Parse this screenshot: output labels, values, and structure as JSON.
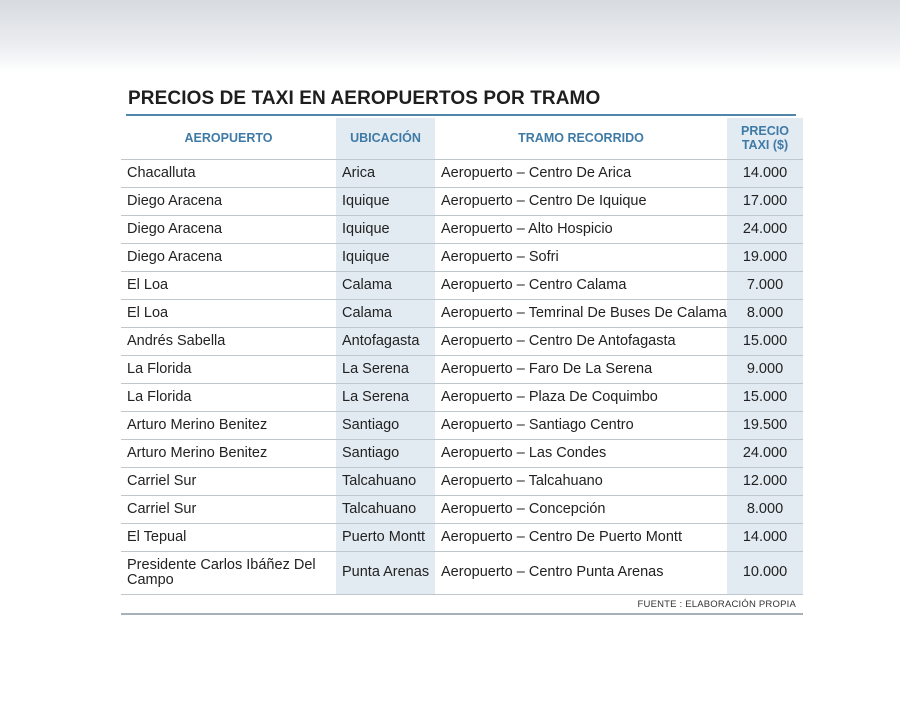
{
  "title": "PRECIOS DE TAXI EN AEROPUERTOS POR TRAMO",
  "columns": {
    "airport": "AEROPUERTO",
    "location": "UBICACIÓN",
    "route": "TRAMO RECORRIDO",
    "price_line1": "PRECIO",
    "price_line2": "TAXI ($)"
  },
  "rows": [
    {
      "airport": "Chacalluta",
      "location": "Arica",
      "route": "Aeropuerto – Centro De Arica",
      "price": "14.000"
    },
    {
      "airport": "Diego Aracena",
      "location": "Iquique",
      "route": "Aeropuerto – Centro De Iquique",
      "price": "17.000"
    },
    {
      "airport": "Diego Aracena",
      "location": "Iquique",
      "route": "Aeropuerto – Alto Hospicio",
      "price": "24.000"
    },
    {
      "airport": "Diego Aracena",
      "location": "Iquique",
      "route": "Aeropuerto – Sofri",
      "price": "19.000"
    },
    {
      "airport": "El Loa",
      "location": "Calama",
      "route": "Aeropuerto – Centro Calama",
      "price": "7.000"
    },
    {
      "airport": "El Loa",
      "location": "Calama",
      "route": "Aeropuerto – Temrinal De Buses De Calama",
      "price": "8.000"
    },
    {
      "airport": "Andrés Sabella",
      "location": "Antofagasta",
      "route": "Aeropuerto – Centro De Antofagasta",
      "price": "15.000"
    },
    {
      "airport": "La Florida",
      "location": "La Serena",
      "route": "Aeropuerto – Faro De La Serena",
      "price": "9.000"
    },
    {
      "airport": "La Florida",
      "location": "La Serena",
      "route": "Aeropuerto – Plaza De Coquimbo",
      "price": "15.000"
    },
    {
      "airport": "Arturo Merino Benitez",
      "location": "Santiago",
      "route": "Aeropuerto – Santiago Centro",
      "price": "19.500"
    },
    {
      "airport": "Arturo Merino Benitez",
      "location": "Santiago",
      "route": "Aeropuerto – Las Condes",
      "price": "24.000"
    },
    {
      "airport": "Carriel Sur",
      "location": "Talcahuano",
      "route": "Aeropuerto – Talcahuano",
      "price": "12.000"
    },
    {
      "airport": "Carriel Sur",
      "location": "Talcahuano",
      "route": "Aeropuerto – Concepción",
      "price": "8.000"
    },
    {
      "airport": "El Tepual",
      "location": "Puerto Montt",
      "route": "Aeropuerto – Centro De Puerto Montt",
      "price": "14.000"
    },
    {
      "airport": "Presidente Carlos Ibáñez Del Campo",
      "location": "Punta Arenas",
      "route": "Aeropuerto – Centro Punta Arenas",
      "price": "10.000"
    }
  ],
  "source": "FUENTE : ELABORACIÓN PROPIA",
  "colors": {
    "header_text": "#3e7aa6",
    "title_rule": "#4f87ab",
    "shaded_column": "#e3ebf2",
    "row_divider": "#bfc6cc"
  }
}
